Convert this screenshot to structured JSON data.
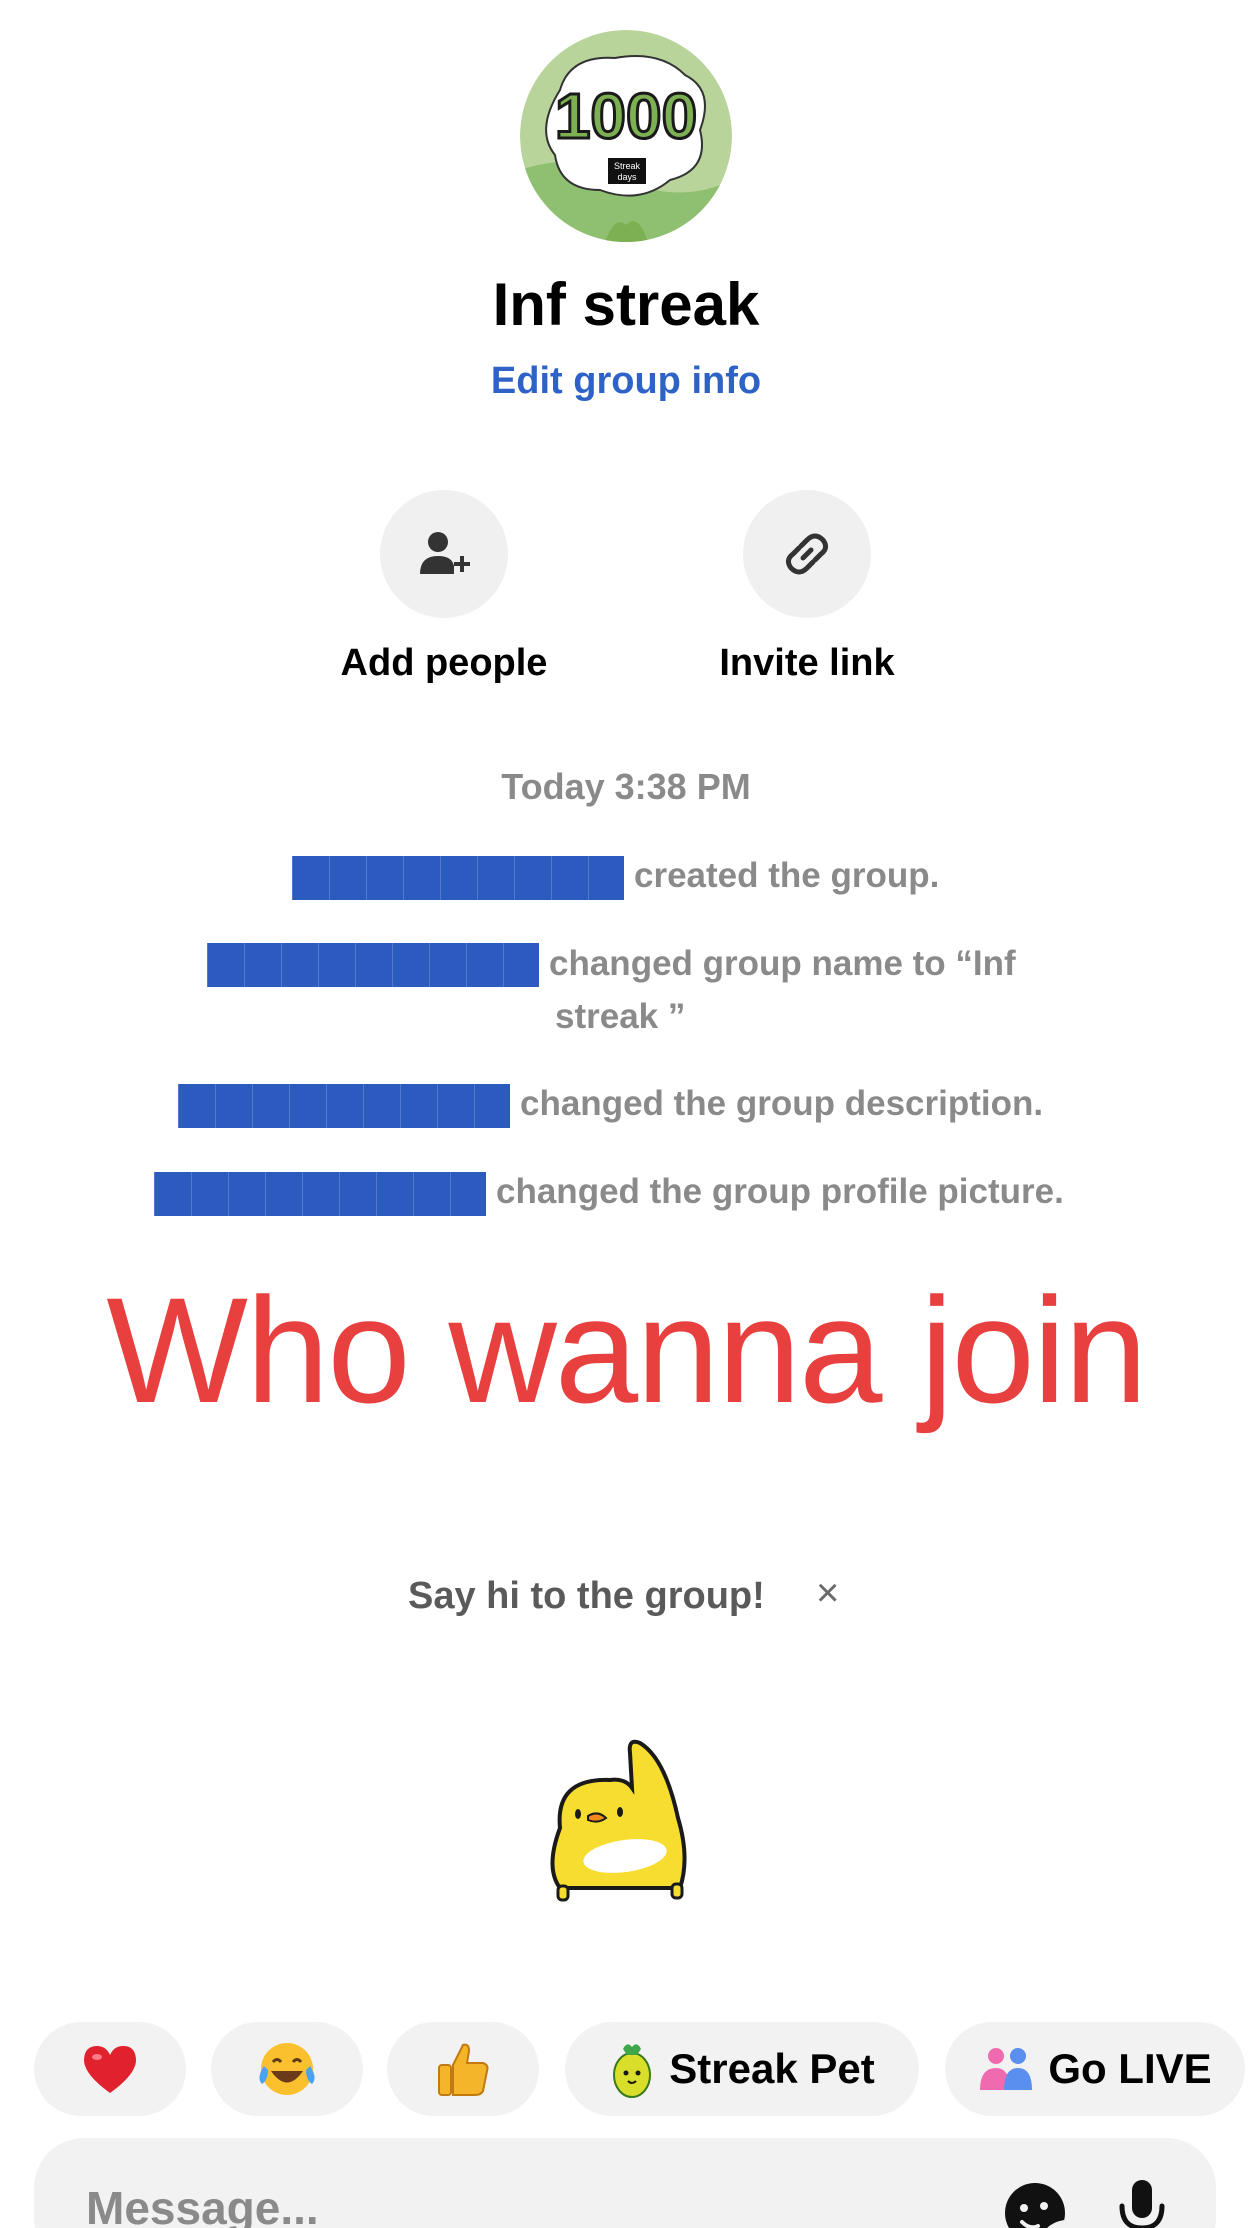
{
  "group": {
    "avatar_text": "1000",
    "avatar_subtext_1": "Streak",
    "avatar_subtext_2": "days",
    "name": "Inf streak",
    "edit_label": "Edit group info"
  },
  "actions": {
    "add_people": "Add people",
    "invite_link": "Invite link"
  },
  "timeline": {
    "timestamp": "Today 3:38 PM",
    "events": [
      {
        "text": "created the group."
      },
      {
        "text_line1": "changed group name to “Inf",
        "text_line2": "streak ”"
      },
      {
        "text": "changed the group description."
      },
      {
        "text": "changed the group profile picture."
      }
    ]
  },
  "overlay_text": "Who wanna join",
  "prompt": {
    "text": "Say hi to the group!",
    "close": "×"
  },
  "quick_actions": [
    {
      "icon": "heart-emoji"
    },
    {
      "icon": "tears-of-joy-emoji"
    },
    {
      "icon": "thumbs-up-emoji"
    },
    {
      "icon": "streak-pet-icon",
      "label": "Streak Pet"
    },
    {
      "icon": "people-icon",
      "label": "Go LIVE"
    }
  ],
  "composer": {
    "placeholder": "Message...",
    "value": ""
  },
  "colors": {
    "accent": "#2f62c7",
    "redaction": "#2b5bbf",
    "overlay": "#e8403f",
    "muted": "#8a8a8a"
  }
}
